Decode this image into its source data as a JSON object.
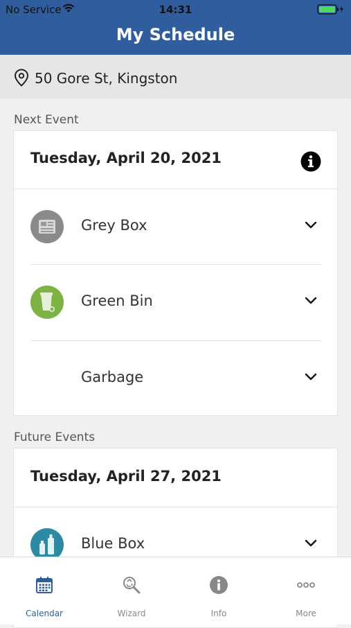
{
  "status_bar": {
    "carrier": "No Service",
    "time": "14:31"
  },
  "header": {
    "title": "My Schedule"
  },
  "address": {
    "text": "50 Gore St, Kingston",
    "icon": "map-pin-icon"
  },
  "next_event": {
    "section_label": "Next Event",
    "date": "Tuesday, April 20, 2021",
    "items": [
      {
        "label": "Grey Box",
        "icon": "grey-box-icon",
        "color": "#8a8a8a"
      },
      {
        "label": "Green Bin",
        "icon": "green-bin-icon",
        "color": "#7cb342"
      },
      {
        "label": "Garbage",
        "icon": "",
        "color": ""
      }
    ]
  },
  "future_events": {
    "section_label": "Future Events",
    "date": "Tuesday, April 27, 2021",
    "items": [
      {
        "label": "Blue Box",
        "icon": "blue-box-icon",
        "color": "#2e8aa3"
      }
    ]
  },
  "tabs": [
    {
      "label": "Calendar",
      "icon": "calendar-icon",
      "active": true
    },
    {
      "label": "Wizard",
      "icon": "recycle-search-icon",
      "active": false
    },
    {
      "label": "Info",
      "icon": "info-icon",
      "active": false
    },
    {
      "label": "More",
      "icon": "more-dots-icon",
      "active": false
    }
  ],
  "colors": {
    "brand": "#2f5d9e",
    "background": "#f0f0f2"
  }
}
